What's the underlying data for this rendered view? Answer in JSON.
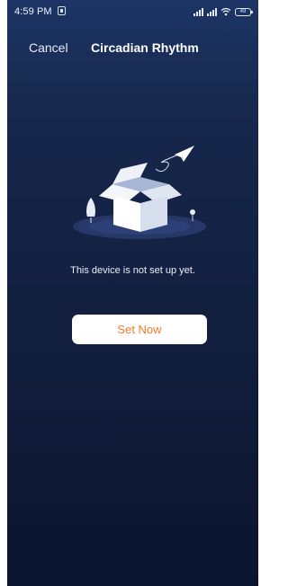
{
  "status_bar": {
    "time": "4:59 PM",
    "battery": "49"
  },
  "nav": {
    "cancel_label": "Cancel",
    "title": "Circadian Rhythm"
  },
  "empty_state": {
    "message": "This device is not set up yet.",
    "button_label": "Set Now"
  },
  "colors": {
    "background_top": "#1d3566",
    "background_bottom": "#0b1430",
    "button_text": "#f07a2b"
  },
  "icons": [
    "notification-icon",
    "signal-icon",
    "wifi-icon",
    "battery-icon",
    "open-box-icon",
    "paper-plane-icon",
    "tree-icon"
  ]
}
